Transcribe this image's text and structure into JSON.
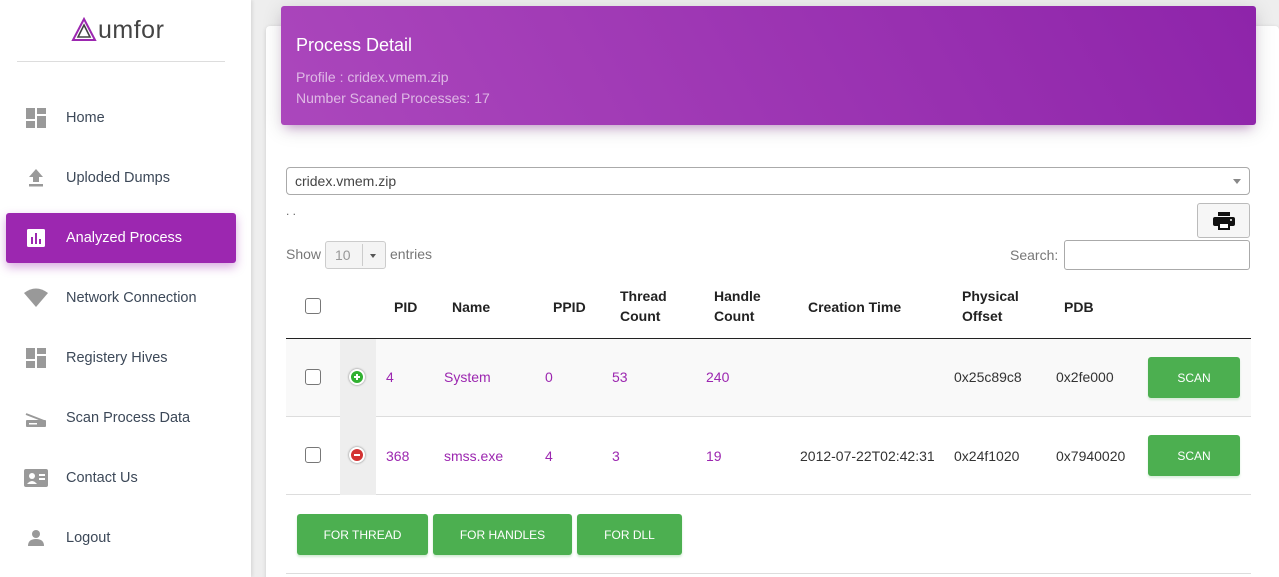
{
  "brand": {
    "name": "umfor"
  },
  "sidebar": {
    "items": [
      {
        "label": "Home",
        "icon": "dashboard-icon",
        "active": false
      },
      {
        "label": "Uploded Dumps",
        "icon": "upload-icon",
        "active": false
      },
      {
        "label": "Analyzed Process",
        "icon": "bar-chart-icon",
        "active": true
      },
      {
        "label": "Network Connection",
        "icon": "wifi-icon",
        "active": false
      },
      {
        "label": "Registery Hives",
        "icon": "dashboard-icon",
        "active": false
      },
      {
        "label": "Scan Process Data",
        "icon": "scanner-icon",
        "active": false
      },
      {
        "label": "Contact Us",
        "icon": "contact-card-icon",
        "active": false
      },
      {
        "label": "Logout",
        "icon": "person-icon",
        "active": false
      }
    ]
  },
  "header": {
    "title": "Process Detail",
    "profile": "Profile : cridex.vmem.zip",
    "count": "Number Scaned Processes: 17"
  },
  "dump_select": {
    "value": "cridex.vmem.zip"
  },
  "dots": ". .",
  "table_controls": {
    "show_label": "Show",
    "page_length": "10",
    "entries_label": "entries",
    "search_label": "Search:"
  },
  "table": {
    "columns": {
      "pid": "PID",
      "name": "Name",
      "ppid": "PPID",
      "thread_1": "Thread",
      "thread_2": "Count",
      "handle_1": "Handle",
      "handle_2": "Count",
      "creation": "Creation Time",
      "phys_1": "Physical",
      "phys_2": "Offset",
      "pdb": "PDB"
    },
    "rows": [
      {
        "pid": "4",
        "name": "System",
        "ppid": "0",
        "threads": "53",
        "handles": "240",
        "creation": "",
        "offset": "0x25c89c8",
        "pdb": "0x2fe000",
        "action": "SCAN",
        "expanded": false
      },
      {
        "pid": "368",
        "name": "smss.exe",
        "ppid": "4",
        "threads": "3",
        "handles": "19",
        "creation": "2012-07-22T02:42:31",
        "offset": "0x24f1020",
        "pdb": "0x7940020",
        "action": "SCAN",
        "expanded": true
      }
    ]
  },
  "actions": {
    "thread": "FOR THREAD",
    "handles": "FOR HANDLES",
    "dll": "FOR DLL"
  },
  "colors": {
    "primary": "#9c27b0",
    "success": "#4caf50"
  }
}
